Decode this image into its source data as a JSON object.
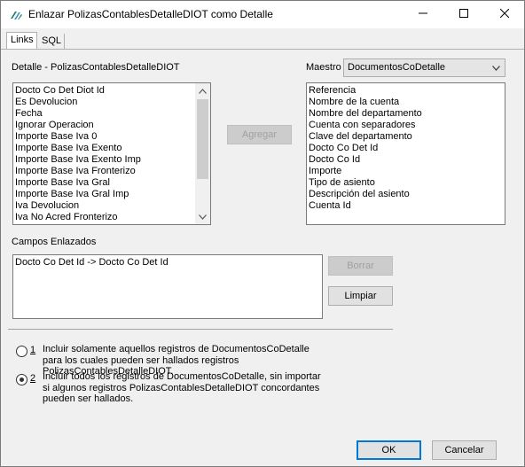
{
  "window": {
    "title": "Enlazar PolizasContablesDetalleDIOT como Detalle"
  },
  "tabs": [
    {
      "label": "Links",
      "active": true
    },
    {
      "label": "SQL",
      "active": false
    }
  ],
  "detalle": {
    "label": "Detalle - PolizasContablesDetalleDIOT",
    "items": [
      "Docto Co Det Diot Id",
      "Es Devolucion",
      "Fecha",
      "Ignorar Operacion",
      "Importe Base Iva 0",
      "Importe Base Iva Exento",
      "Importe Base Iva Exento Imp",
      "Importe Base Iva Fronterizo",
      "Importe Base Iva Gral",
      "Importe Base Iva Gral Imp",
      "Iva Devolucion",
      "Iva No Acred Fronterizo"
    ]
  },
  "maestro": {
    "label": "Maestro",
    "selected": "DocumentosCoDetalle",
    "items": [
      "Referencia",
      "Nombre de la cuenta",
      "Nombre del departamento",
      "Cuenta con separadores",
      "Clave del departamento",
      "Docto Co Det Id",
      "Docto Co Id",
      "Importe",
      "Tipo de asiento",
      "Descripción del asiento",
      "Cuenta Id"
    ]
  },
  "buttons": {
    "agregar": "Agregar",
    "borrar": "Borrar",
    "limpiar": "Limpiar",
    "ok": "OK",
    "cancelar": "Cancelar"
  },
  "campos": {
    "label": "Campos Enlazados",
    "items": [
      "Docto Co Det Id -> Docto Co Det Id"
    ]
  },
  "options": [
    {
      "number": "1",
      "checked": false,
      "lines": [
        "Incluir solamente aquellos registros de DocumentosCoDetalle",
        "para los cuales pueden ser hallados registros",
        "PolizasContablesDetalleDIOT."
      ]
    },
    {
      "number": "2",
      "checked": true,
      "lines": [
        "Incluir todos los registros de DocumentosCoDetalle, sin importar",
        "si algunos registros PolizasContablesDetalleDIOT concordantes",
        "pueden ser hallados."
      ]
    }
  ],
  "icons": {
    "app": "app-link-icon",
    "minimize": "minimize-icon",
    "maximize": "maximize-icon",
    "close": "close-icon",
    "scroll_up": "chevron-up-icon",
    "scroll_down": "chevron-down-icon",
    "dropdown": "chevron-down-icon"
  },
  "colors": {
    "accent": "#0078d7",
    "window_bg": "#f0f0f0"
  }
}
